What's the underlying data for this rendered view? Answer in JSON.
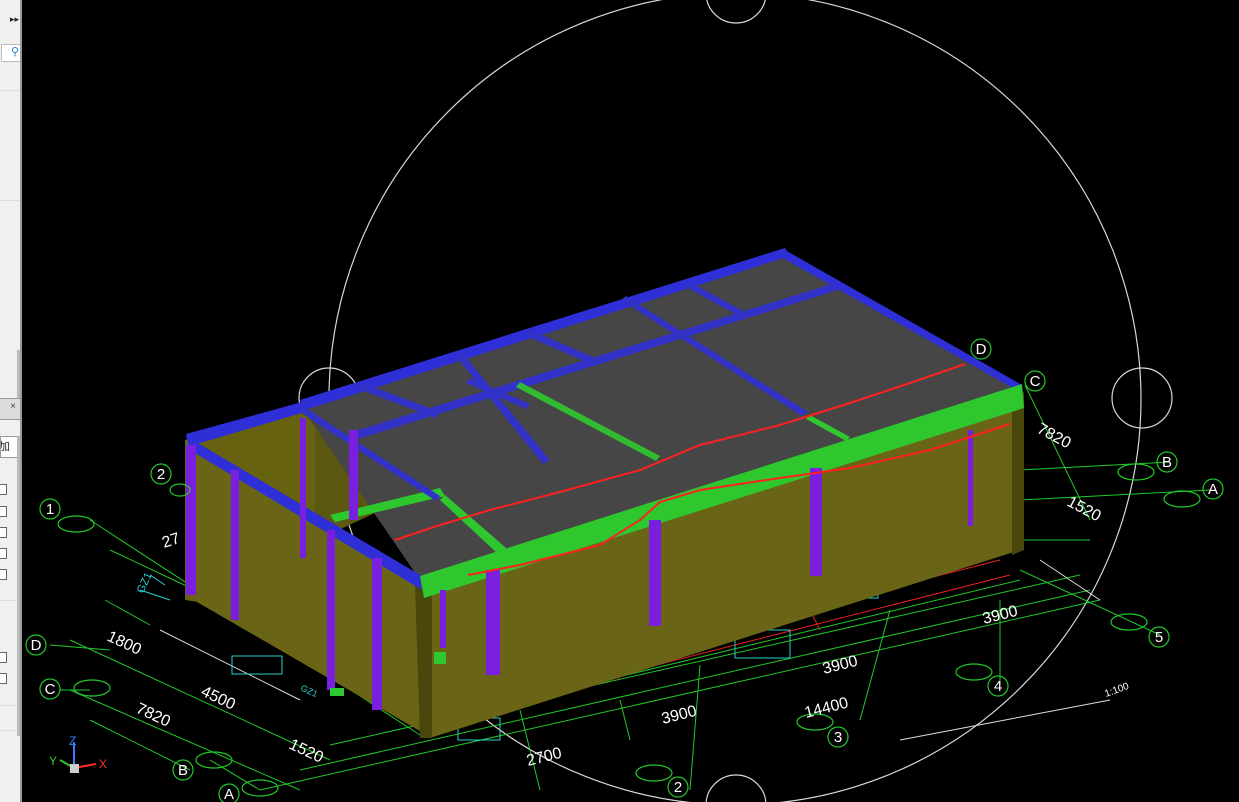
{
  "app": {
    "expand_glyph": "▸▸",
    "search_icon": "magnifier",
    "panel_close": "×",
    "panel_tab_label": "加"
  },
  "axes": {
    "left_column": [
      "1",
      "2",
      "D",
      "C",
      "B",
      "A"
    ],
    "right_column": [
      "D",
      "C",
      "B",
      "A",
      "5",
      "4",
      "3",
      "2"
    ]
  },
  "dimensions": {
    "left_1800": "1800",
    "left_4500": "4500",
    "left_7820": "7820",
    "left_1520": "1520",
    "left_2700": "27",
    "front_2700": "2700",
    "front_3900_a": "3900",
    "front_3900_b": "3900",
    "front_3900_c": "3900",
    "total_14400": "14400",
    "right_7820": "7820",
    "right_1520": "1520",
    "scale": "1:100"
  },
  "labels": {
    "gz1": "GZ1",
    "gz1_small": "GZ1"
  },
  "viewcube": {
    "x_label": "X",
    "y_label": "Y",
    "z_label": "Z"
  },
  "colors": {
    "background": "#000000",
    "grid_green": "#22c82a",
    "beam_blue": "#2f2fd8",
    "beam_green": "#2ec82e",
    "wall_olive": "#6a6516",
    "column_purple": "#7a1ee0",
    "slab_grey": "#464646",
    "rebar_red": "#ff2020",
    "orbit_white": "#d8d8d8"
  }
}
